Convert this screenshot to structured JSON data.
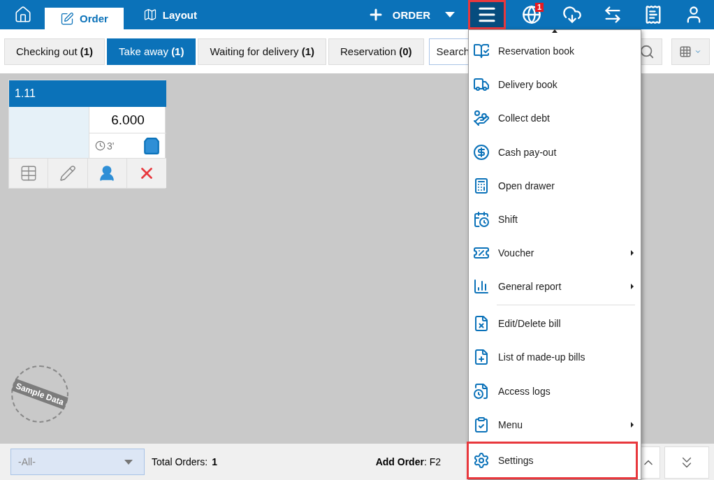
{
  "top_tabs": [
    {
      "kind": "home",
      "selected": false
    },
    {
      "kind": "order",
      "label": "Order",
      "selected": true
    },
    {
      "kind": "layout",
      "label": "Layout",
      "selected": false
    }
  ],
  "new_order": {
    "label": "ORDER"
  },
  "menu_button": {
    "open": true
  },
  "toolbar_icons": [
    {
      "kind": "globe",
      "badge": "1"
    },
    {
      "kind": "cloud-download"
    },
    {
      "kind": "sync"
    },
    {
      "kind": "receipt"
    },
    {
      "kind": "user"
    }
  ],
  "filters": [
    {
      "label": "Checking out",
      "count": "(1)",
      "selected": false
    },
    {
      "label": "Take away",
      "count": "(1)",
      "selected": true
    },
    {
      "label": "Waiting for delivery",
      "count": "(1)",
      "selected": false
    },
    {
      "label": "Reservation",
      "count": "(0)",
      "selected": false
    }
  ],
  "search": {
    "placeholder": "Search"
  },
  "orders": [
    {
      "name": "1.11",
      "amount": "6.000",
      "elapsed": "3'"
    }
  ],
  "stamp": "Sample Data",
  "menu": {
    "items": [
      {
        "kind": "book",
        "label": "Reservation book",
        "submenu": false,
        "divider_before": false,
        "selected": false
      },
      {
        "kind": "delivery",
        "label": "Delivery book",
        "submenu": false,
        "divider_before": false,
        "selected": false
      },
      {
        "kind": "coins",
        "label": "Collect debt",
        "submenu": false,
        "divider_before": false,
        "selected": false
      },
      {
        "kind": "safe",
        "label": "Cash pay-out",
        "submenu": false,
        "divider_before": false,
        "selected": false
      },
      {
        "kind": "register",
        "label": "Open drawer",
        "submenu": false,
        "divider_before": false,
        "selected": false
      },
      {
        "kind": "calendar",
        "label": "Shift",
        "submenu": false,
        "divider_before": false,
        "selected": false
      },
      {
        "kind": "voucher",
        "label": "Voucher",
        "submenu": true,
        "divider_before": false,
        "selected": false
      },
      {
        "kind": "chart",
        "label": "General report",
        "submenu": true,
        "divider_before": false,
        "selected": false
      },
      {
        "kind": "bill-x",
        "label": "Edit/Delete bill",
        "submenu": false,
        "divider_before": true,
        "selected": false
      },
      {
        "kind": "bill-plus",
        "label": "List of made-up bills",
        "submenu": false,
        "divider_before": false,
        "selected": false
      },
      {
        "kind": "log",
        "label": "Access logs",
        "submenu": false,
        "divider_before": false,
        "selected": false
      },
      {
        "kind": "clipboard",
        "label": "Menu",
        "submenu": true,
        "divider_before": false,
        "selected": false
      },
      {
        "kind": "gear",
        "label": "Settings",
        "submenu": false,
        "divider_before": false,
        "selected": true
      }
    ]
  },
  "footer": {
    "area_filter": "-All-",
    "total_label": "Total Orders:",
    "total": "1",
    "shortcut_label": "Add Order",
    "shortcut_key": ": F2"
  }
}
